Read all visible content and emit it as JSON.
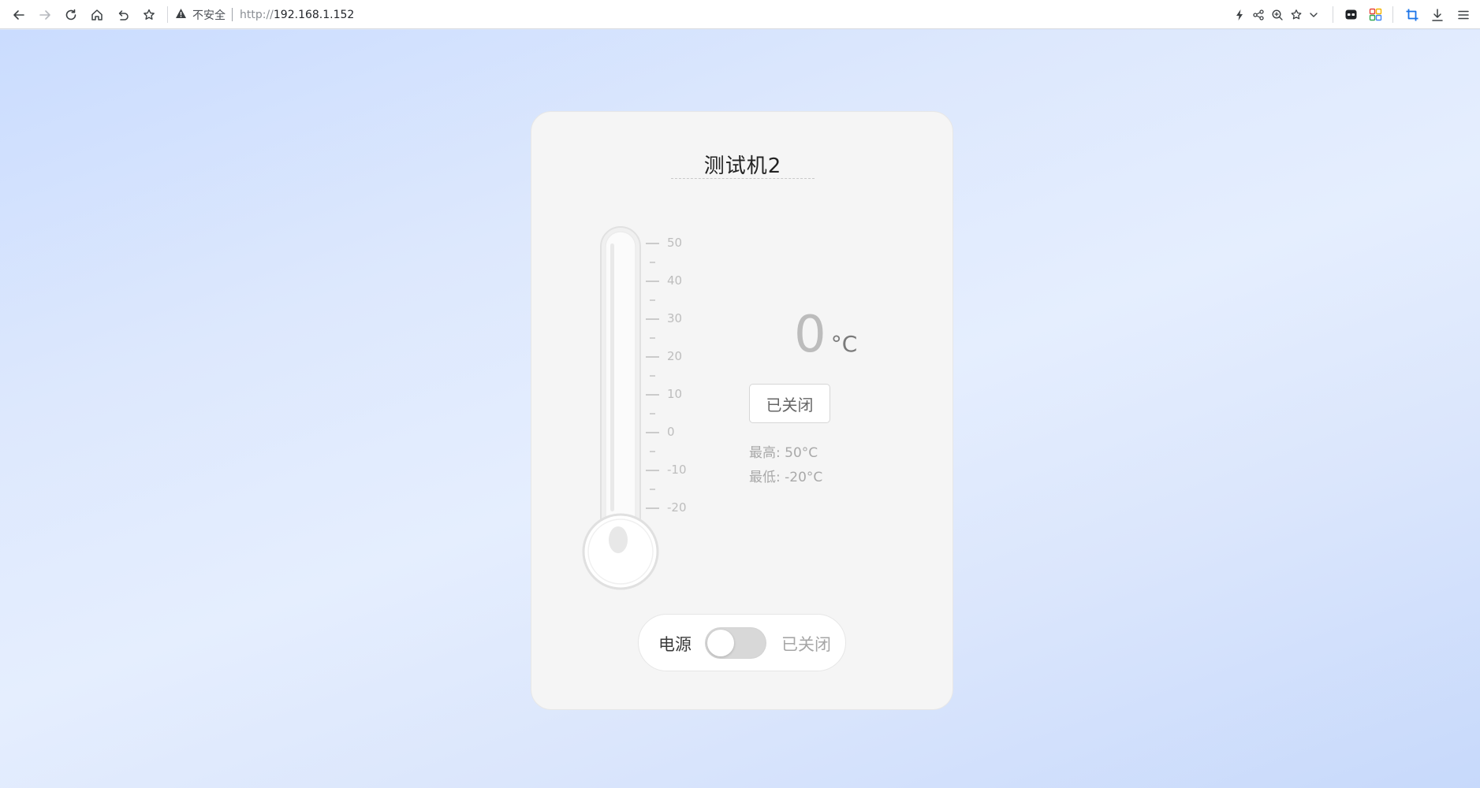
{
  "browser": {
    "security_label": "不安全",
    "url_protocol": "http://",
    "url_host": "192.168.1.152",
    "icons": [
      "back-icon",
      "forward-icon",
      "reload-icon",
      "home-icon",
      "undo-icon",
      "bookmark-star-icon",
      "lightning-icon",
      "share-icon",
      "zoom-icon",
      "favorites-star-icon",
      "chevron-down-icon",
      "extension-icon",
      "apps-grid-icon",
      "crop-icon",
      "download-icon",
      "menu-icon"
    ]
  },
  "device": {
    "name": "测试机2",
    "temperature": "0",
    "unit": "°C",
    "status": "已关闭",
    "max_label": "最高: 50°C",
    "min_label": "最低: -20°C",
    "scale": [
      "50",
      "40",
      "30",
      "20",
      "10",
      "0",
      "-10",
      "-20"
    ],
    "temperature_value": 0,
    "scale_min": -20,
    "scale_max": 50
  },
  "power": {
    "label": "电源",
    "state": "已关闭",
    "on": false
  },
  "colors": {
    "card_bg": "#f5f5f5",
    "scale_color": "#bdbdbd",
    "switch_off": "#d8d8d8"
  }
}
